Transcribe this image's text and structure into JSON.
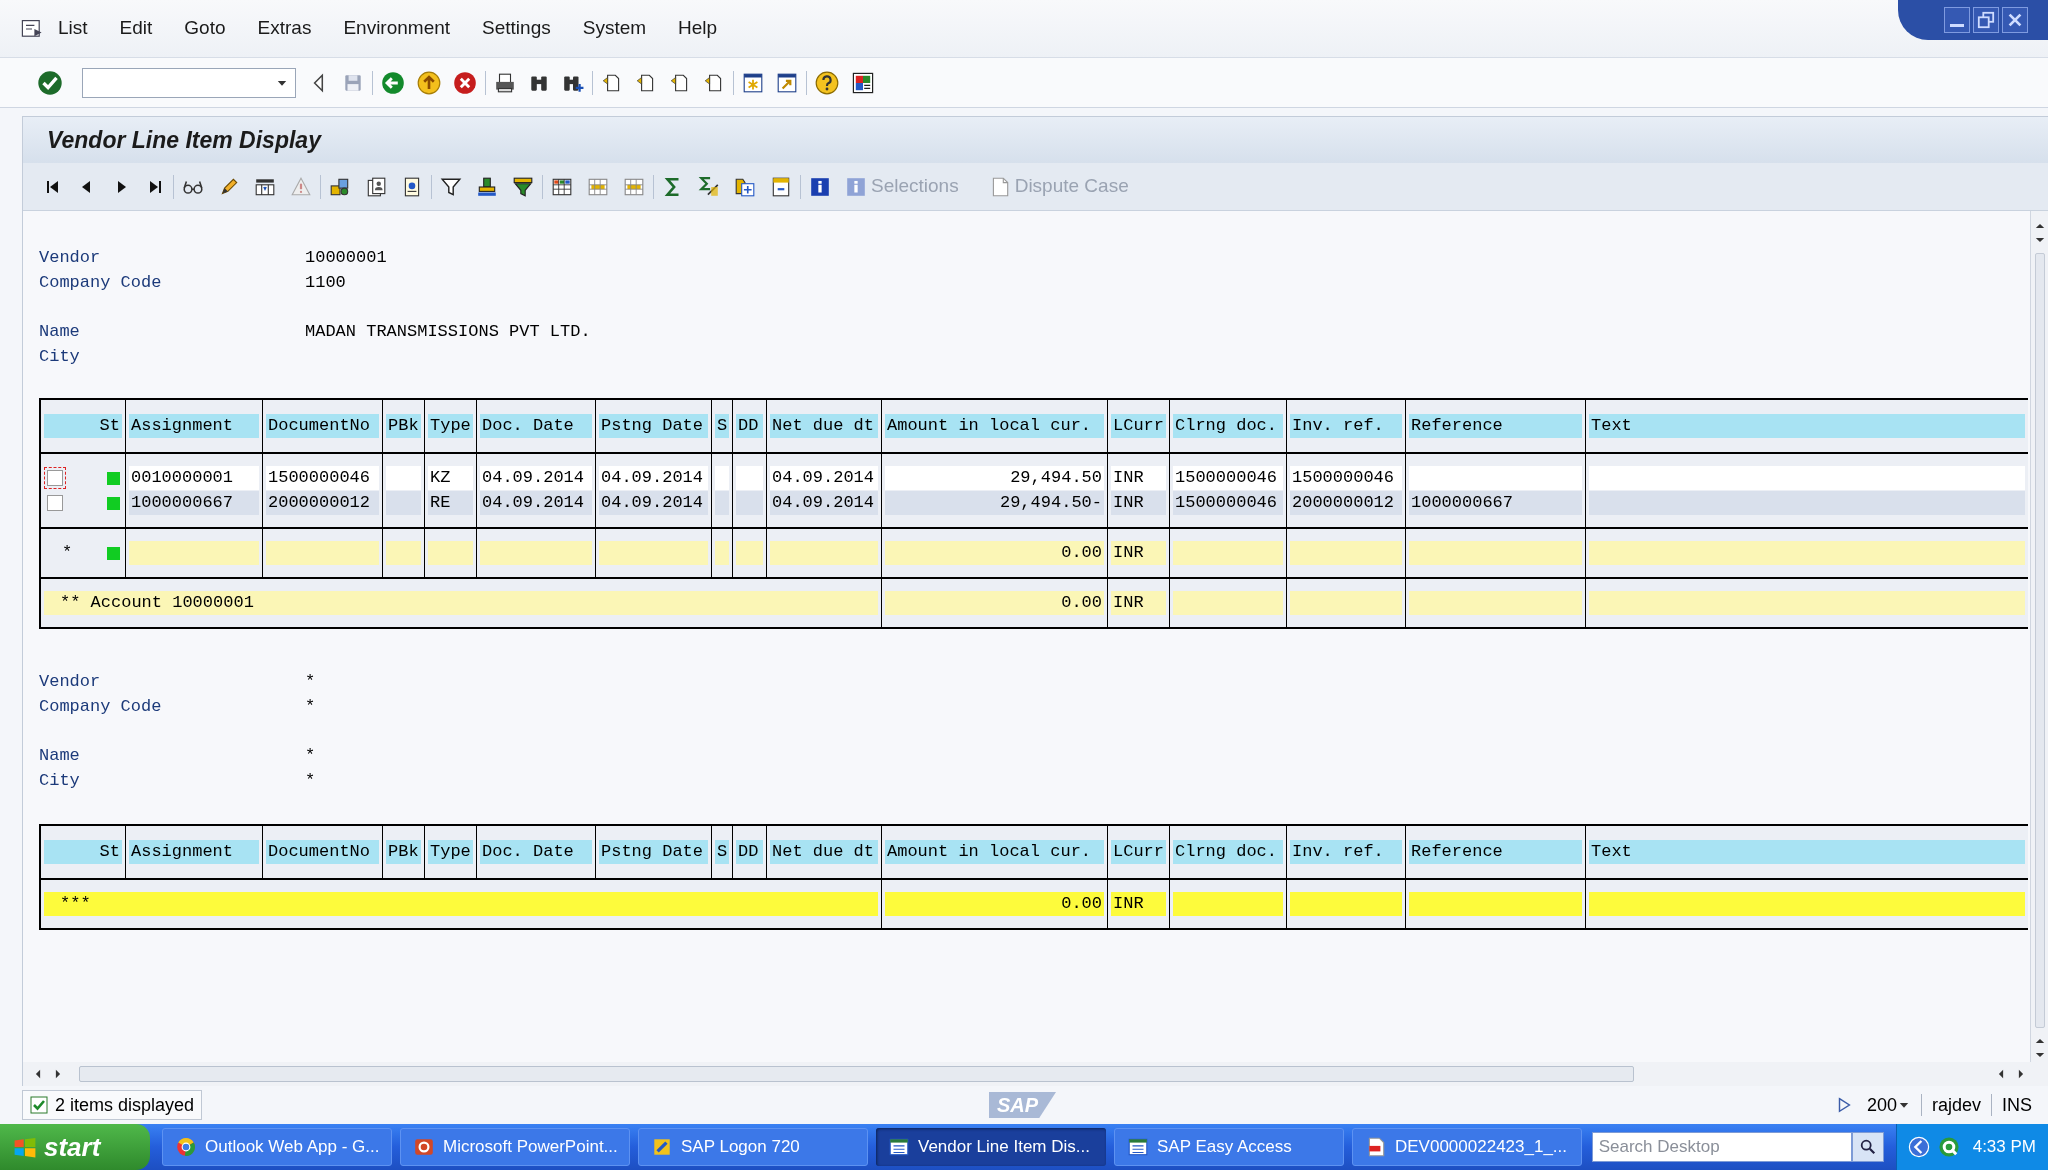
{
  "menu": [
    {
      "label": "List"
    },
    {
      "label": "Edit"
    },
    {
      "label": "Goto"
    },
    {
      "label": "Extras"
    },
    {
      "label": "Environment"
    },
    {
      "label": "Settings"
    },
    {
      "label": "System"
    },
    {
      "label": "Help"
    }
  ],
  "title": "Vendor Line Item Display",
  "app_buttons": [
    {
      "label": "Selections",
      "disabled": true
    },
    {
      "label": "Dispute Case",
      "disabled": true
    }
  ],
  "sections": [
    {
      "field_groups": [
        [
          {
            "label": "Vendor",
            "value": "10000001"
          },
          {
            "label": "Company Code",
            "value": "1100"
          }
        ],
        [
          {
            "label": "Name",
            "value": "MADAN TRANSMISSIONS PVT LTD."
          },
          {
            "label": "City"
          }
        ]
      ],
      "table": {
        "columns": [
          "St",
          "Assignment",
          "DocumentNo",
          "PBk",
          "Type",
          "Doc. Date",
          "Pstng Date",
          "S",
          "DD",
          "Net due dt",
          "Amount in local cur.",
          "LCurr",
          "Clrng doc.",
          "Inv. ref.",
          "Reference",
          "Text"
        ],
        "rows": [
          {
            "kind": "item",
            "checked": false,
            "focused": true,
            "color": "#11cc22",
            "cells": [
              "0010000001",
              "1500000046",
              null,
              "KZ",
              "04.09.2014",
              "04.09.2014",
              null,
              null,
              "04.09.2014",
              "29,494.50",
              "INR",
              "1500000046",
              "1500000046",
              null,
              null
            ]
          },
          {
            "kind": "item",
            "checked": false,
            "focused": false,
            "color": "#11cc22",
            "cells": [
              "1000000667",
              "2000000012",
              null,
              "RE",
              "04.09.2014",
              "04.09.2014",
              null,
              null,
              "04.09.2014",
              "29,494.50-",
              "INR",
              "1500000046",
              "2000000012",
              "1000000667",
              null
            ]
          },
          {
            "kind": "subtotal",
            "marker": "*",
            "color": "#11cc22",
            "amount": "0.00",
            "currency": "INR"
          },
          {
            "kind": "total",
            "label": "** Account 10000001",
            "amount": "0.00",
            "currency": "INR"
          }
        ]
      }
    },
    {
      "field_groups": [
        [
          {
            "label": "Vendor",
            "value": "*"
          },
          {
            "label": "Company Code",
            "value": "*"
          }
        ],
        [
          {
            "label": "Name",
            "value": "*"
          },
          {
            "label": "City",
            "value": "*"
          }
        ]
      ],
      "table": {
        "columns": [
          "St",
          "Assignment",
          "DocumentNo",
          "PBk",
          "Type",
          "Doc. Date",
          "Pstng Date",
          "S",
          "DD",
          "Net due dt",
          "Amount in local cur.",
          "LCurr",
          "Clrng doc.",
          "Inv. ref.",
          "Reference",
          "Text"
        ],
        "rows": [
          {
            "kind": "grand_total",
            "label": "***",
            "amount": "0.00",
            "currency": "INR"
          }
        ]
      }
    }
  ],
  "status_bar": {
    "message": "2 items displayed",
    "logo": "SAP",
    "session": "200",
    "user": "rajdev",
    "mode": "INS"
  },
  "taskbar": {
    "start": "start",
    "tasks": [
      {
        "label": "Outlook Web App - G...",
        "selected": false
      },
      {
        "label": "Microsoft PowerPoint...",
        "selected": false
      },
      {
        "label": "SAP Logon 720",
        "selected": false
      },
      {
        "label": "Vendor Line Item Dis...",
        "selected": true
      },
      {
        "label": "SAP Easy Access",
        "selected": false
      },
      {
        "label": "DEV0000022423_1_...",
        "selected": false
      }
    ],
    "search": {
      "placeholder": "Search Desktop"
    },
    "clock": "4:33 PM"
  }
}
